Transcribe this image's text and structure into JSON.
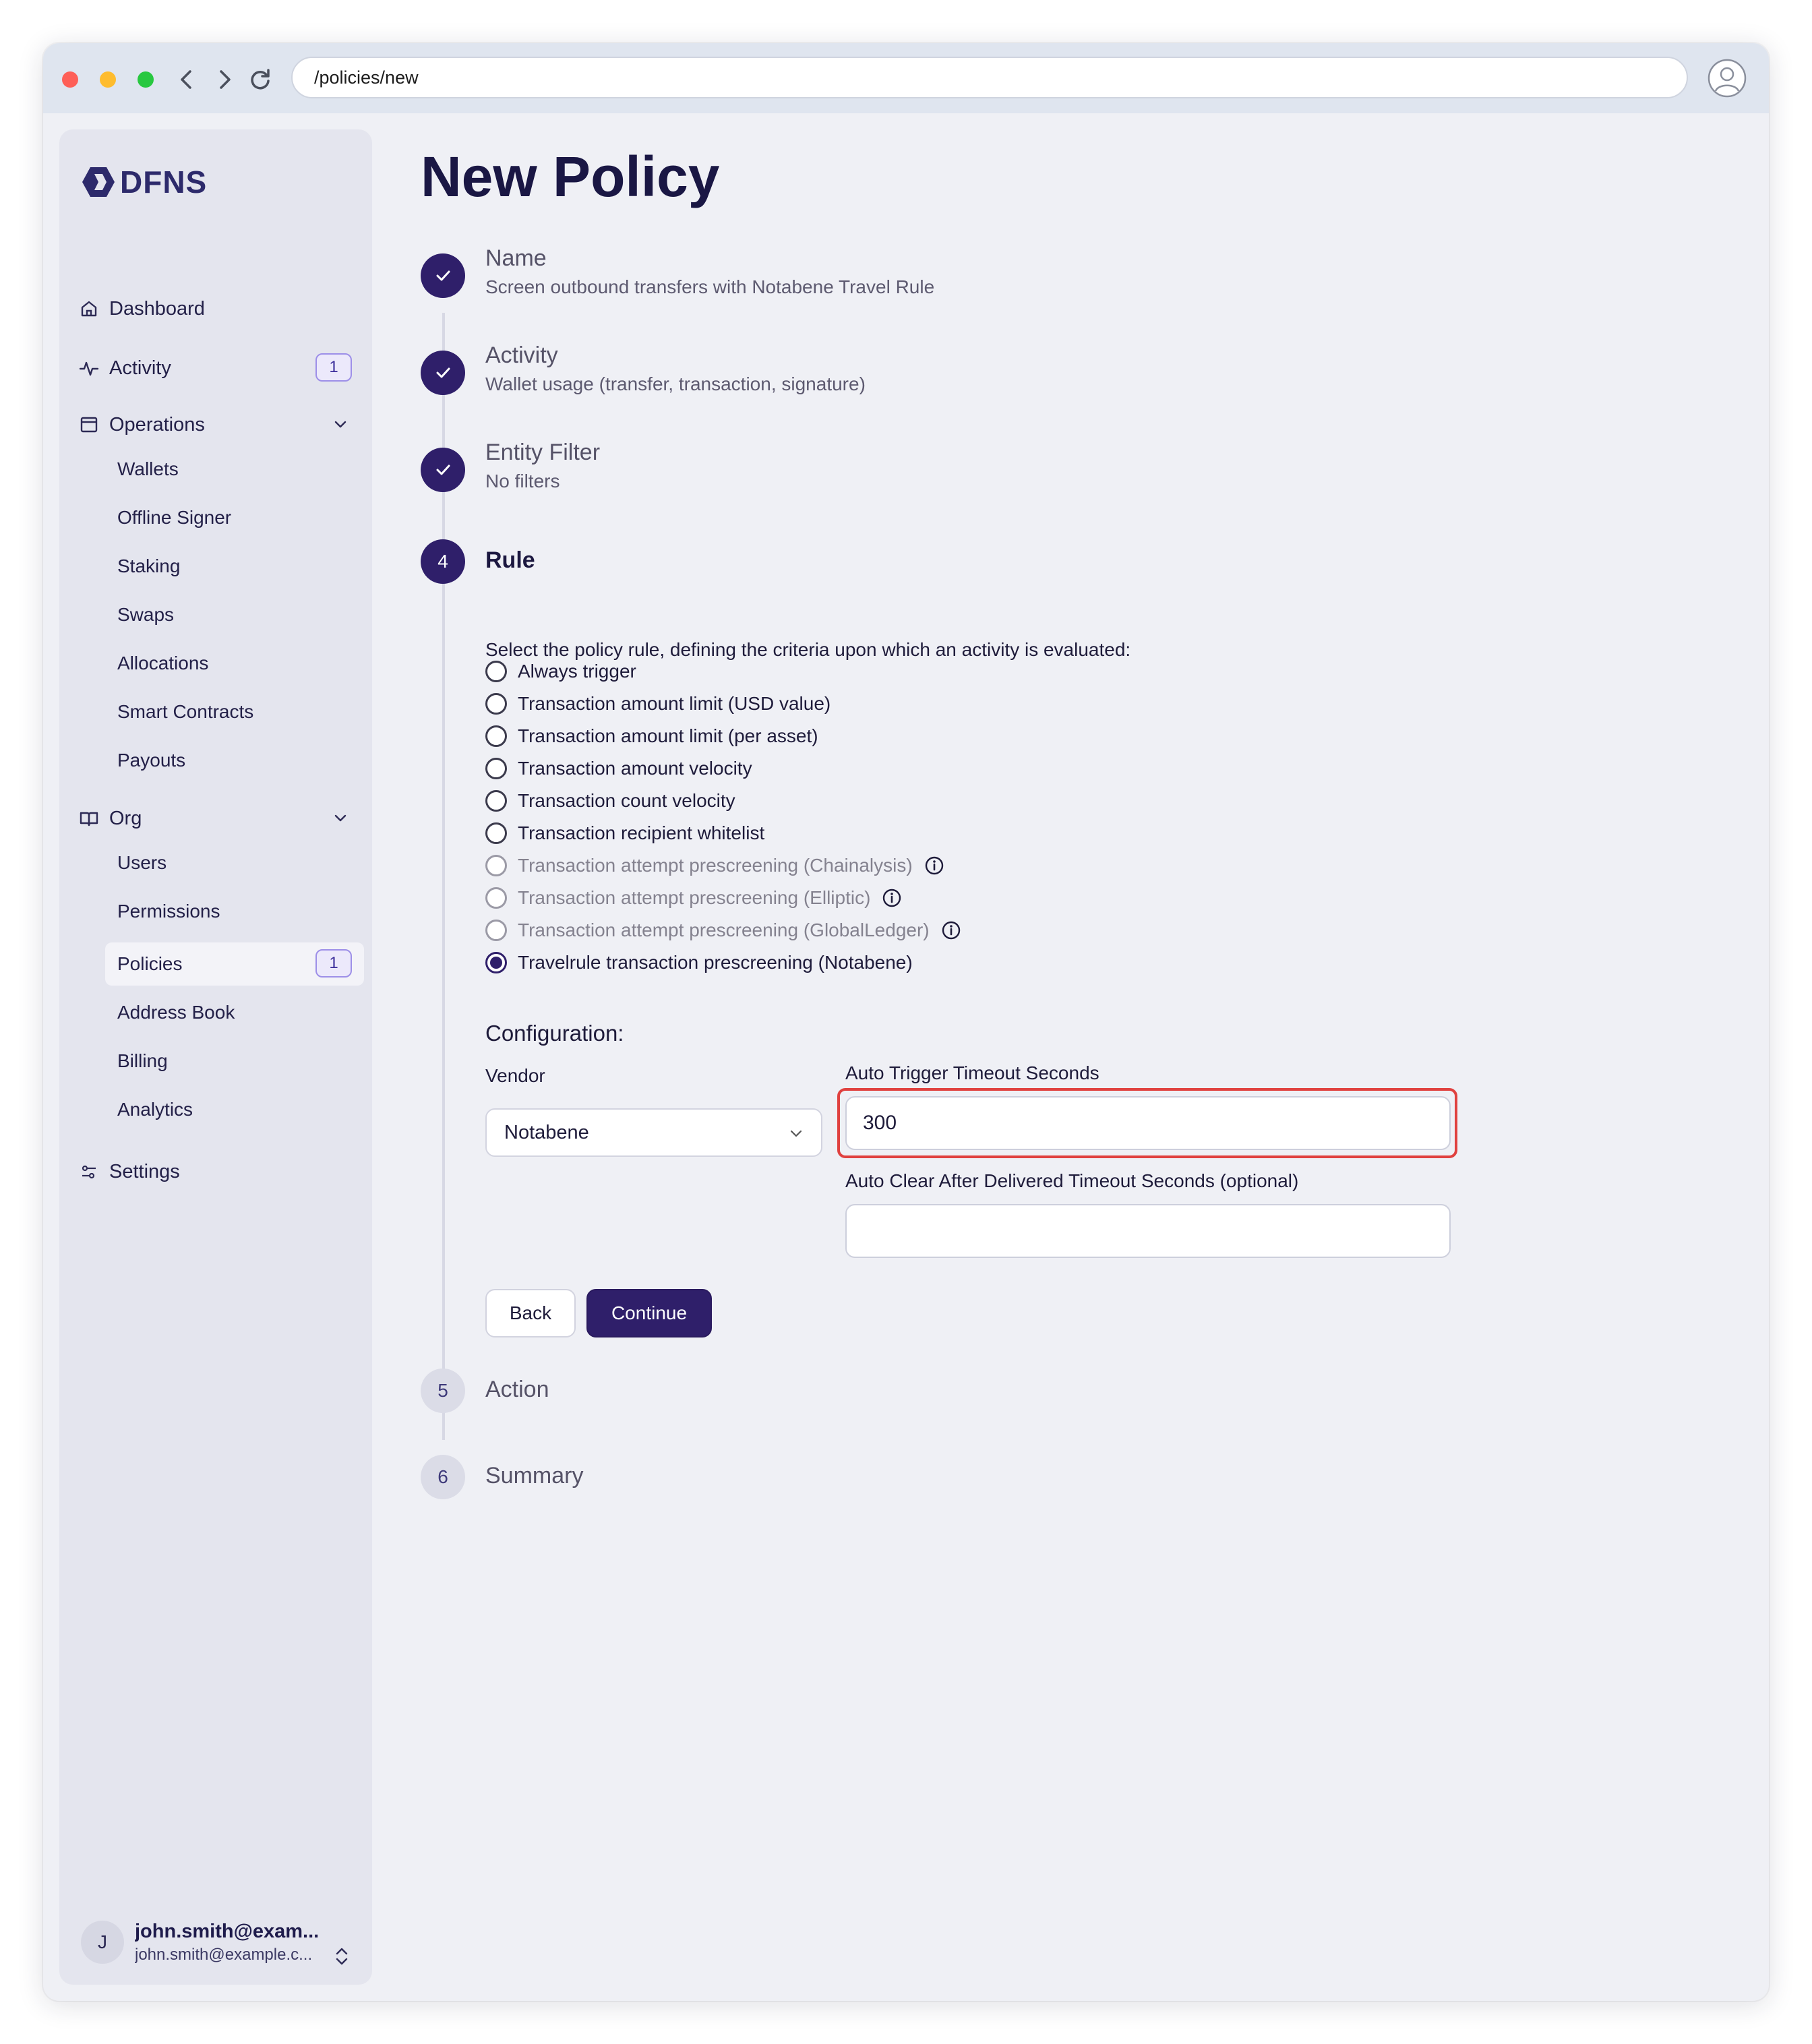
{
  "browser": {
    "url": "/policies/new"
  },
  "brand": {
    "name": "DFNS"
  },
  "sidebar": {
    "dashboard": "Dashboard",
    "activity": {
      "label": "Activity",
      "badge": "1"
    },
    "operations": {
      "label": "Operations",
      "items": [
        "Wallets",
        "Offline Signer",
        "Staking",
        "Swaps",
        "Allocations",
        "Smart Contracts",
        "Payouts"
      ]
    },
    "org": {
      "label": "Org",
      "items": [
        "Users",
        "Permissions",
        "Policies",
        "Address Book",
        "Billing",
        "Analytics"
      ],
      "policies_badge": "1"
    },
    "settings": "Settings",
    "user": {
      "initial": "J",
      "name": "john.smith@exam...",
      "email": "john.smith@example.c..."
    }
  },
  "page": {
    "title": "New Policy"
  },
  "steps": [
    {
      "number": "1",
      "title": "Name",
      "summary": "Screen outbound transfers with Notabene Travel Rule",
      "status": "done"
    },
    {
      "number": "2",
      "title": "Activity",
      "summary": "Wallet usage (transfer, transaction, signature)",
      "status": "done"
    },
    {
      "number": "3",
      "title": "Entity Filter",
      "summary": "No filters",
      "status": "done"
    },
    {
      "number": "4",
      "title": "Rule",
      "status": "active"
    },
    {
      "number": "5",
      "title": "Action",
      "status": "pending"
    },
    {
      "number": "6",
      "title": "Summary",
      "status": "pending"
    }
  ],
  "rule": {
    "intro": "Select the policy rule, defining the criteria upon which an activity is evaluated:",
    "options": [
      {
        "label": "Always trigger",
        "disabled": false,
        "checked": false
      },
      {
        "label": "Transaction amount limit (USD value)",
        "disabled": false,
        "checked": false
      },
      {
        "label": "Transaction amount limit (per asset)",
        "disabled": false,
        "checked": false
      },
      {
        "label": "Transaction amount velocity",
        "disabled": false,
        "checked": false
      },
      {
        "label": "Transaction count velocity",
        "disabled": false,
        "checked": false
      },
      {
        "label": "Transaction recipient whitelist",
        "disabled": false,
        "checked": false
      },
      {
        "label": "Transaction attempt prescreening (Chainalysis)",
        "disabled": true,
        "checked": false
      },
      {
        "label": "Transaction attempt prescreening (Elliptic)",
        "disabled": true,
        "checked": false
      },
      {
        "label": "Transaction attempt prescreening (GlobalLedger)",
        "disabled": true,
        "checked": false
      },
      {
        "label": "Travelrule transaction prescreening (Notabene)",
        "disabled": false,
        "checked": true
      }
    ],
    "configuration": {
      "heading": "Configuration:",
      "vendor_label": "Vendor",
      "vendor_value": "Notabene",
      "auto_trigger_label": "Auto Trigger Timeout Seconds",
      "auto_trigger_value": "300",
      "auto_clear_label": "Auto Clear After Delivered Timeout Seconds (optional)",
      "auto_clear_value": ""
    },
    "buttons": {
      "back": "Back",
      "continue": "Continue"
    }
  },
  "colors": {
    "primary": "#2f1f6a",
    "highlight": "#e0413f",
    "badge_border": "#9d8fe8"
  }
}
